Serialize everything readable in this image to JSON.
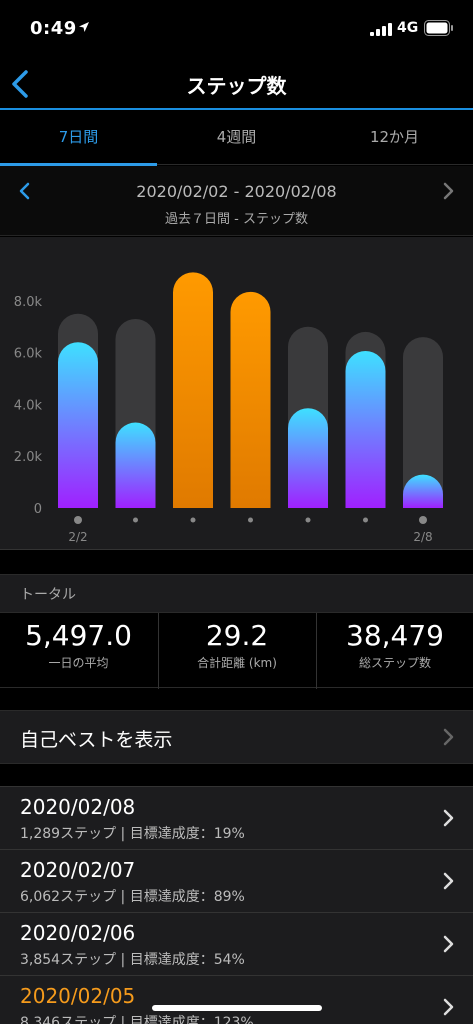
{
  "status_bar": {
    "time": "0:49",
    "network": "4G"
  },
  "nav": {
    "title": "ステップ数"
  },
  "tabs": [
    {
      "label": "7日間",
      "active": true
    },
    {
      "label": "4週間",
      "active": false
    },
    {
      "label": "12か月",
      "active": false
    }
  ],
  "range": {
    "dates": "2020/02/02 - 2020/02/08",
    "subtitle": "過去７日間 - ステップ数"
  },
  "chart_data": {
    "type": "bar",
    "categories": [
      "2/2",
      "",
      "",
      "",
      "",
      "",
      "2/8"
    ],
    "values": [
      6400,
      3300,
      9100,
      8346,
      3854,
      6062,
      1289
    ],
    "goals": [
      7500,
      7300,
      9100,
      8346,
      7000,
      6800,
      6600
    ],
    "goal_met": [
      false,
      false,
      true,
      true,
      false,
      false,
      false
    ],
    "y_ticks": [
      "0",
      "2.0k",
      "4.0k",
      "6.0k",
      "8.0k"
    ],
    "ylim": [
      0,
      9500
    ],
    "colors": {
      "gradient_top": "#3ee0ff",
      "gradient_bottom": "#a020ff",
      "goal_met": "#ff9a00",
      "goal_track": "#3a3a3c"
    }
  },
  "totals": {
    "header": "トータル",
    "stats": [
      {
        "value": "5,497.0",
        "label": "一日の平均"
      },
      {
        "value": "29.2",
        "label": "合計距離 (km)"
      },
      {
        "value": "38,479",
        "label": "総ステップ数"
      }
    ]
  },
  "best": {
    "label": "自己ベストを表示"
  },
  "days": [
    {
      "date": "2020/02/08",
      "detail": "1,289ステップ | 目標達成度：19%",
      "highlight": false
    },
    {
      "date": "2020/02/07",
      "detail": "6,062ステップ | 目標達成度：89%",
      "highlight": false
    },
    {
      "date": "2020/02/06",
      "detail": "3,854ステップ | 目標達成度：54%",
      "highlight": false
    },
    {
      "date": "2020/02/05",
      "detail": "8,346ステップ | 目標達成度：123%",
      "highlight": true
    }
  ],
  "accent_color": "#2d9be8"
}
